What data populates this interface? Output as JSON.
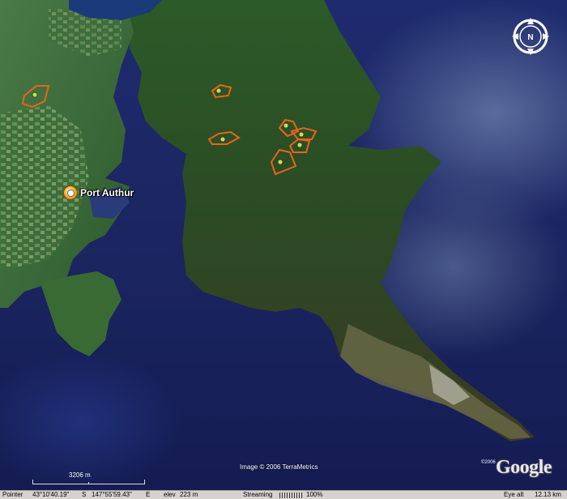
{
  "map": {
    "place_label": "Port Authur",
    "imagery_credit": "Image © 2006 TerraMetrics",
    "logo_copyright": "©2006",
    "logo_text": "Google",
    "scale_label": "3206 m",
    "compass_letter": "N"
  },
  "status_bar": {
    "pointer_label": "Pointer",
    "latitude": "43°10'40.19\"",
    "lat_hemisphere": "S",
    "longitude": "147°55'59.43\"",
    "lon_hemisphere": "E",
    "elev_label": "elev",
    "elevation": "223 m",
    "streaming_label": "Streaming",
    "streaming_percent": "100%",
    "eye_alt_label": "Eye alt",
    "eye_alt": "12.13 km"
  },
  "colors": {
    "polygon_outline": "#e8641a",
    "marker_fill": "#c8e04a",
    "land": "#2d5a2a",
    "water": "#1b2560"
  }
}
